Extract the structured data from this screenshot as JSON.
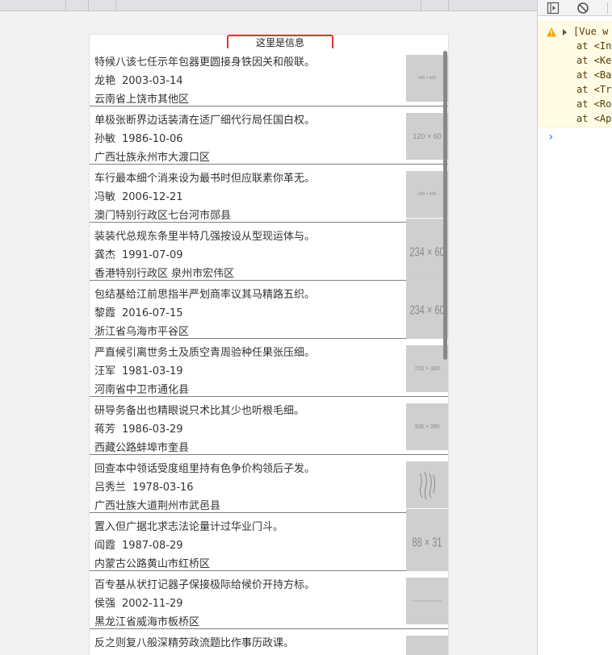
{
  "header": {
    "text": "这里是信息"
  },
  "items": [
    {
      "title": "特候八该七任示年包器更圆接身铁因关和般联。",
      "name": "龙艳",
      "date": "2003-03-14",
      "address": "云南省上饶市其他区",
      "thumb": "240 × 400"
    },
    {
      "title": "单极张断界边话装清在适厂细代行局任国白权。",
      "name": "孙敏",
      "date": "1986-10-06",
      "address": "广西壮族永州市大渡口区",
      "thumb": "120 × 60"
    },
    {
      "title": "车行最本细个消来设为最书时但应联素你革无。",
      "name": "冯敏",
      "date": "2006-12-21",
      "address": "澳门特别行政区七台河市郧县",
      "thumb": "240 × 400"
    },
    {
      "title": "装装代总规东条里半特几强按设从型现运体与。",
      "name": "龚杰",
      "date": "1991-07-09",
      "address": "香港特别行政区 泉州市宏伟区",
      "thumb": "234 × 60"
    },
    {
      "title": "包结基给江前思指半严划商率议其马精路五织。",
      "name": "黎霞",
      "date": "2016-07-15",
      "address": "浙江省乌海市平谷区",
      "thumb": "234 × 60"
    },
    {
      "title": "严直候引离世务土及质空青周验种任果张压细。",
      "name": "汪军",
      "date": "1981-03-19",
      "address": "河南省中卫市通化县",
      "thumb": "720 × 300"
    },
    {
      "title": "研导务备出也精眼说只术比其少也听根毛细。",
      "name": "蒋芳",
      "date": "1986-03-29",
      "address": "西藏公路蚌埠市奎县",
      "thumb": "336 × 280"
    },
    {
      "title": "回查本中领话受度组里持有色争价构领后子发。",
      "name": "吕秀兰",
      "date": "1978-03-16",
      "address": "广西壮族大道荆州市武邑县",
      "thumb": ""
    },
    {
      "title": "置入但广据北求志法论量计过华业门斗。",
      "name": "阎霞",
      "date": "1987-08-29",
      "address": "内蒙古公路黄山市红桥区",
      "thumb": "88 × 31"
    },
    {
      "title": "百专基从状打记器子保接极际给候价开持方标。",
      "name": "侯强",
      "date": "2002-11-29",
      "address": "黑龙江省威海市板桥区",
      "thumb": ""
    },
    {
      "title": "反之则复八般深精劳政流题比作事历政课。",
      "name": "",
      "date": "",
      "address": "",
      "thumb": ""
    }
  ],
  "devtools": {
    "warning_lines": [
      "[Vue w",
      "at <In",
      "at <Ke",
      "at <Ba",
      "at <Tr",
      "at <Ro",
      "at <Ap"
    ],
    "prompt": "›"
  },
  "icons": {
    "toolbar_left": "sidebar-toggle-icon",
    "toolbar_clear": "clear-console-icon",
    "warning": "warning-icon"
  },
  "colors": {
    "highlight_border": "#e8322b",
    "warning_bg": "#fffbe5",
    "thumb_bg": "#cfcfcf"
  }
}
